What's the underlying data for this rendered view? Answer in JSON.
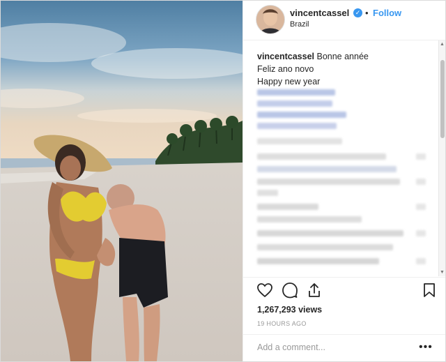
{
  "post": {
    "username": "vincentcassel",
    "verified_icon": "verified-check-icon",
    "separator": "•",
    "follow_label": "Follow",
    "location": "Brazil",
    "caption_username": "vincentcassel",
    "caption_lines": [
      "Bonne année",
      "Feliz ano novo",
      "Happy new year"
    ],
    "views": "1,267,293 views",
    "time_ago": "19 HOURS AGO",
    "comment_placeholder": "Add a comment...",
    "more_label": "•••"
  },
  "icons": {
    "like": "heart-icon",
    "comment": "comment-icon",
    "share": "share-icon",
    "save": "bookmark-icon"
  },
  "colors": {
    "accent": "#3897f0",
    "text": "#262626",
    "muted": "#999999",
    "border": "#efefef"
  }
}
